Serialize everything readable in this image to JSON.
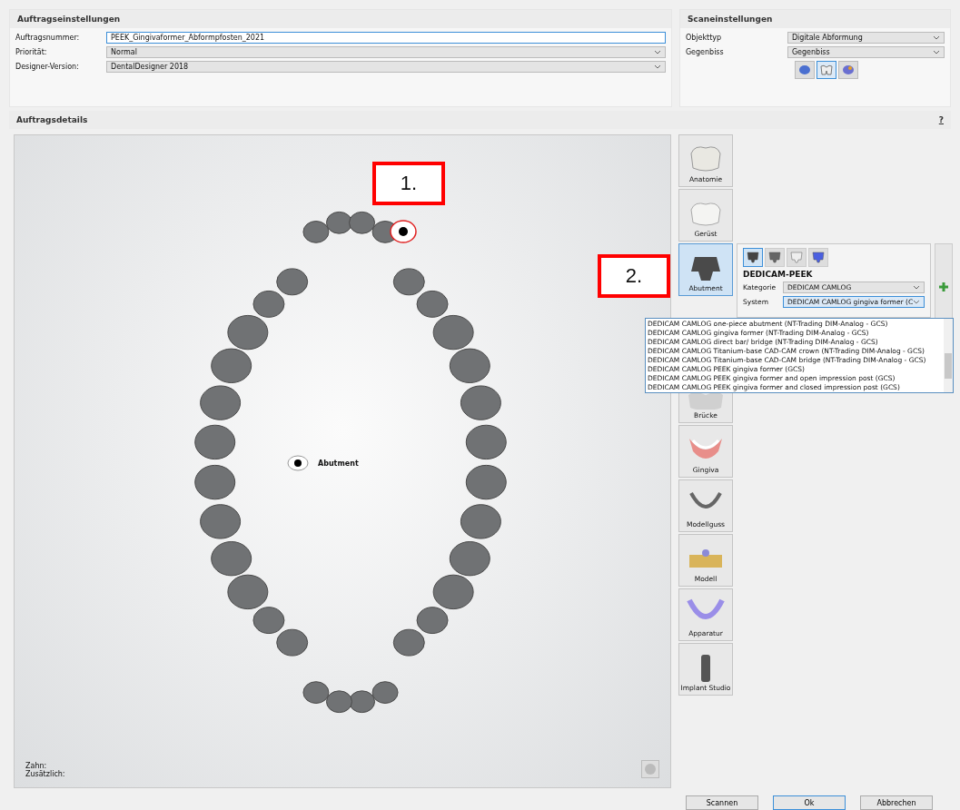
{
  "order_settings": {
    "title": "Auftragseinstellungen",
    "fields": [
      {
        "kind": "input",
        "label": "Auftragsnummer:",
        "value": "PEEK_Gingivaformer_Abformpfosten_2021"
      },
      {
        "kind": "select",
        "label": "Priorität:",
        "value": "Normal"
      },
      {
        "kind": "select",
        "label": "Designer-Version:",
        "value": "DentalDesigner 2018"
      }
    ]
  },
  "scan_settings": {
    "title": "Scaneinstellungen",
    "fields": [
      {
        "label": "Objekttyp",
        "value": "Digitale Abformung"
      },
      {
        "label": "Gegenbiss",
        "value": "Gegenbiss"
      }
    ],
    "scan_icons": [
      {
        "kind": "jaw",
        "selected": false
      },
      {
        "kind": "teeth",
        "selected": true
      },
      {
        "kind": "bite",
        "selected": false
      }
    ]
  },
  "order_details": {
    "title": "Auftragsdetails",
    "help": "?",
    "legend": "Abutment",
    "tooth_label": "Zahn:",
    "extra_label": "Zusätzlich:"
  },
  "sidebar": {
    "items": [
      {
        "kind": "anatomy",
        "label": "Anatomie",
        "selected": false
      },
      {
        "kind": "framework",
        "label": "Gerüst",
        "selected": false
      },
      {
        "kind": "abutment",
        "label": "Abutment",
        "selected": true
      },
      {
        "kind": "bridge",
        "label": "Brücke",
        "selected": false
      },
      {
        "kind": "gingiva",
        "label": "Gingiva",
        "selected": false
      },
      {
        "kind": "cast",
        "label": "Modellguss",
        "selected": false
      },
      {
        "kind": "model",
        "label": "Modell",
        "selected": false
      },
      {
        "kind": "appliance",
        "label": "Apparatur",
        "selected": false
      },
      {
        "kind": "implant",
        "label": "Implant Studio",
        "selected": false
      }
    ]
  },
  "abutment_panel": {
    "variants": [
      {
        "kind": "dark",
        "selected": true
      },
      {
        "kind": "grey",
        "selected": false
      },
      {
        "kind": "white",
        "selected": false
      },
      {
        "kind": "blue",
        "selected": false
      }
    ],
    "title": "DEDICAM-PEEK",
    "category_label": "Kategorie",
    "category": "DEDICAM CAMLOG",
    "system_label": "System",
    "system": "DEDICAM CAMLOG gingiva former (C"
  },
  "system_options": [
    "DEDICAM CAMLOG one-piece abutment (NT-Trading DIM-Analog - GCS)",
    "DEDICAM CAMLOG gingiva former (NT-Trading DIM-Analog - GCS)",
    "DEDICAM CAMLOG direct bar/ bridge (NT-Trading DIM-Analog - GCS)",
    "DEDICAM CAMLOG Titanium-base CAD-CAM crown (NT-Trading DIM-Analog - GCS)",
    "DEDICAM CAMLOG Titanium-base CAD-CAM bridge (NT-Trading DIM-Analog - GCS)",
    "DEDICAM CAMLOG PEEK gingiva former (GCS)",
    "DEDICAM CAMLOG PEEK gingiva former and open impression post (GCS)",
    "DEDICAM CAMLOG PEEK gingiva former and closed impression post (GCS)"
  ],
  "annotations": [
    "1.",
    "2."
  ],
  "buttons": [
    "Scannen",
    "Ok",
    "Abbrechen"
  ]
}
